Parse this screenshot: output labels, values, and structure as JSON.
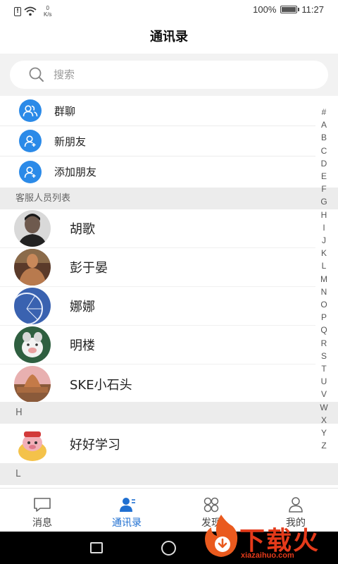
{
  "status_bar": {
    "speed_value": "0",
    "speed_unit": "K/s",
    "battery": "100%",
    "battery_level": 1.0,
    "time": "11:27"
  },
  "header": {
    "title": "通讯录"
  },
  "search": {
    "placeholder": "搜索"
  },
  "functions": [
    {
      "label": "群聊",
      "icon": "group-icon"
    },
    {
      "label": "新朋友",
      "icon": "new-friend-icon"
    },
    {
      "label": "添加朋友",
      "icon": "add-friend-icon"
    }
  ],
  "sections": {
    "service": "客服人员列表",
    "h": "H",
    "l": "L"
  },
  "contacts": [
    {
      "name": "胡歌",
      "avatar": "avatar-man-portrait"
    },
    {
      "name": "彭于晏",
      "avatar": "avatar-man-shirtless"
    },
    {
      "name": "娜娜",
      "avatar": "avatar-ferris-wheel"
    },
    {
      "name": "明楼",
      "avatar": "avatar-cartoon-pig"
    },
    {
      "name": "SKE小石头",
      "avatar": "avatar-cityscape"
    },
    {
      "name": "好好学习",
      "avatar": "avatar-cartoon-character"
    }
  ],
  "index_letters": [
    "#",
    "A",
    "B",
    "C",
    "D",
    "E",
    "F",
    "G",
    "H",
    "I",
    "J",
    "K",
    "L",
    "M",
    "N",
    "O",
    "P",
    "Q",
    "R",
    "S",
    "T",
    "U",
    "V",
    "W",
    "X",
    "Y",
    "Z"
  ],
  "tabs": [
    {
      "label": "消息",
      "icon": "message-icon",
      "active": false
    },
    {
      "label": "通讯录",
      "icon": "contacts-icon",
      "active": true
    },
    {
      "label": "发现",
      "icon": "discover-icon",
      "active": false
    },
    {
      "label": "我的",
      "icon": "profile-icon",
      "active": false
    }
  ],
  "watermark": {
    "text": "下载火",
    "url": "xiazaihuo.com"
  },
  "colors": {
    "accent": "#2b8ae8",
    "active_tab": "#1f6fd1",
    "watermark": "#e43a1a"
  }
}
